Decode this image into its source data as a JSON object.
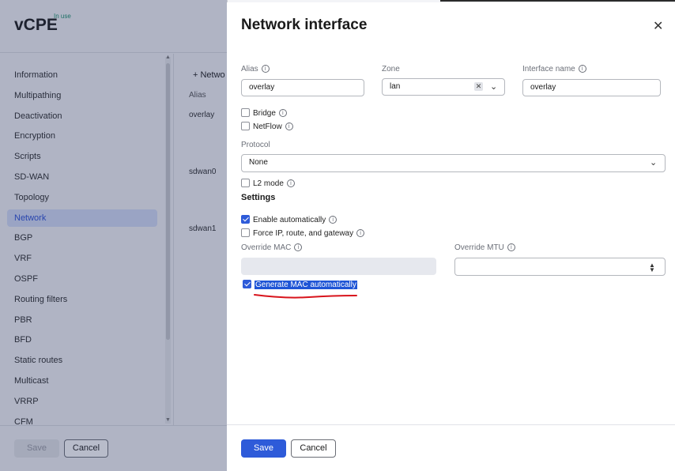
{
  "background_page": {
    "app_title": "vCPE",
    "app_badge": "In use",
    "nav_items": [
      "Information",
      "Multipathing",
      "Deactivation",
      "Encryption",
      "Scripts",
      "SD-WAN",
      "Topology",
      "Network",
      "BGP",
      "VRF",
      "OSPF",
      "Routing filters",
      "PBR",
      "BFD",
      "Static routes",
      "Multicast",
      "VRRP",
      "CFM"
    ],
    "active_nav": "Network",
    "add_button": "+ Netwo",
    "table": {
      "column_alias": "Alias",
      "rows": [
        "overlay",
        "sdwan0",
        "sdwan1"
      ]
    },
    "footer": {
      "save": "Save",
      "cancel": "Cancel"
    }
  },
  "drawer": {
    "title": "Network interface",
    "close_icon": "close-icon",
    "alias": {
      "label": "Alias",
      "value": "overlay"
    },
    "zone": {
      "label": "Zone",
      "value": "lan"
    },
    "interface_name": {
      "label": "Interface name",
      "value": "overlay"
    },
    "bridge": {
      "label": "Bridge",
      "checked": false
    },
    "netflow": {
      "label": "NetFlow",
      "checked": false
    },
    "protocol": {
      "label": "Protocol",
      "value": "None"
    },
    "l2mode": {
      "label": "L2 mode",
      "checked": false
    },
    "settings_heading": "Settings",
    "enable_automatically": {
      "label": "Enable automatically",
      "checked": true
    },
    "force_ip": {
      "label": "Force IP, route, and gateway",
      "checked": false
    },
    "override_mac": {
      "label": "Override MAC",
      "value": ""
    },
    "override_mtu": {
      "label": "Override MTU",
      "value": ""
    },
    "generate_mac": {
      "label": "Generate MAC automatically",
      "checked": true
    },
    "footer": {
      "save": "Save",
      "cancel": "Cancel"
    }
  },
  "colors": {
    "accent": "#2e5bd9",
    "annotation": "#d8141c"
  }
}
